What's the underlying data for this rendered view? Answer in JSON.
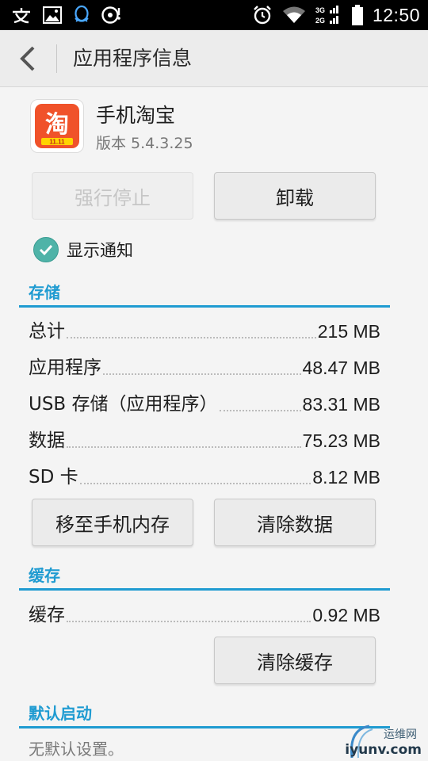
{
  "status_bar": {
    "time": "12:50",
    "network_top": "3G",
    "network_bottom": "2G",
    "icons": [
      "input-method-icon",
      "gallery-icon",
      "qq-icon",
      "music-notification-icon",
      "alarm-icon",
      "wifi-icon",
      "signal-icon",
      "battery-icon"
    ]
  },
  "action_bar": {
    "title": "应用程序信息"
  },
  "app": {
    "name": "手机淘宝",
    "version": "版本 5.4.3.25",
    "icon_glyph": "淘",
    "icon_badge": "11.11"
  },
  "buttons": {
    "force_stop": "强行停止",
    "uninstall": "卸载",
    "move_to_phone": "移至手机内存",
    "clear_data": "清除数据",
    "clear_cache": "清除缓存"
  },
  "notifications": {
    "label": "显示通知",
    "checked": true
  },
  "storage": {
    "title": "存储",
    "rows": [
      {
        "label": "总计",
        "value": "215 MB"
      },
      {
        "label": "应用程序",
        "value": "48.47 MB"
      },
      {
        "label": "USB 存储（应用程序）",
        "value": "83.31 MB"
      },
      {
        "label": "数据",
        "value": "75.23 MB"
      },
      {
        "label": "SD 卡",
        "value": "8.12 MB"
      }
    ]
  },
  "cache": {
    "title": "缓存",
    "label": "缓存",
    "value": "0.92 MB"
  },
  "default_launch": {
    "title": "默认启动",
    "status": "无默认设置。"
  },
  "watermark": {
    "top": "运维网",
    "bottom": "iyunv.com"
  },
  "colors": {
    "accent": "#1f9bd1",
    "checkbox": "#4fb3a8",
    "app_icon": "#f0522a"
  }
}
